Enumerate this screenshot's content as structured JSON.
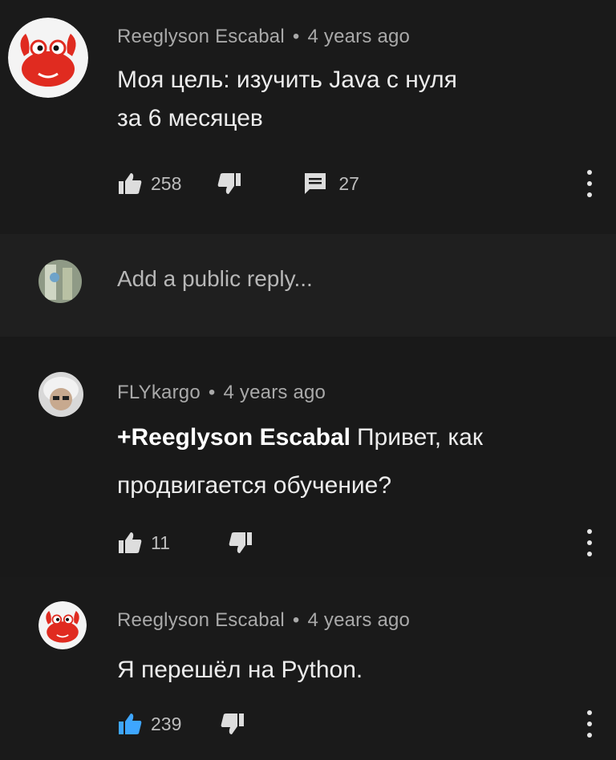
{
  "comments": [
    {
      "author": "Reeglyson Escabal",
      "time": "4 years ago",
      "text_line1": "Моя цель: изучить Java с нуля",
      "text_line2": "за 6 месяцев",
      "likes": "258",
      "replies": "27"
    },
    {
      "author": "FLYkargo",
      "time": "4 years ago",
      "mention": "+Reeglyson Escabal",
      "text_line1": "Привет, как",
      "text_line2": "продвигается обучение?",
      "likes": "11"
    },
    {
      "author": "Reeglyson Escabal",
      "time": "4 years ago",
      "text_line1": "Я перешёл на Python.",
      "likes": "239"
    }
  ],
  "reply_box": {
    "placeholder": "Add a public reply..."
  },
  "separator": "•",
  "colors": {
    "background": "#181818",
    "text": "#e9e9e9",
    "meta": "#a9a9a9",
    "crab_red": "#e02b20",
    "like_active": "#3ea6ff"
  },
  "icons": [
    "like-icon",
    "dislike-icon",
    "reply-icon",
    "more-vert-icon",
    "crab-avatar-icon"
  ]
}
